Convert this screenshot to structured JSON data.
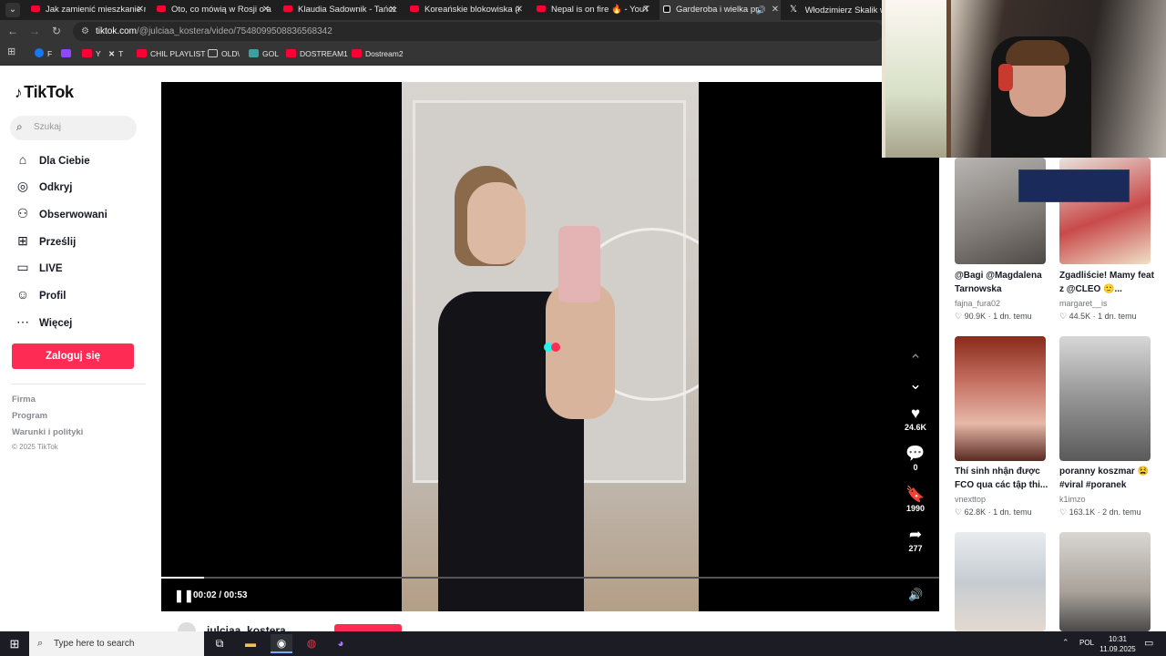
{
  "browser": {
    "tabs": [
      {
        "title": "Jak zamienić mieszkanie n",
        "icon": "youtube-icon"
      },
      {
        "title": "Oto, co mówią w Rosji o a",
        "icon": "youtube-icon"
      },
      {
        "title": "Klaudia Sadownik - Tańcz",
        "icon": "youtube-icon"
      },
      {
        "title": "Koreańskie blokowiska (i",
        "icon": "youtube-icon"
      },
      {
        "title": "Nepal is on fire 🔥 - YouT",
        "icon": "youtube-icon"
      },
      {
        "title": "Garderoba i wielka pr",
        "icon": "tiktok-icon",
        "active": true
      },
      {
        "title": "Włodzimierz Skalik w sej",
        "icon": "x-icon"
      }
    ],
    "url_host": "tiktok.com",
    "url_path": "/@julciaa_kostera/video/7548099508836568342",
    "bookmarks": [
      "F",
      "",
      "Y",
      "T",
      "CHIL PLAYLIST",
      "OLD\\",
      "GOL",
      "DOSTREAM1",
      "Dostream2"
    ]
  },
  "tiktok": {
    "brand": "TikTok",
    "search_placeholder": "Szukaj",
    "nav": [
      "Dla Ciebie",
      "Odkryj",
      "Obserwowani",
      "Prześlij",
      "LIVE",
      "Profil",
      "Więcej"
    ],
    "login_label": "Zaloguj się",
    "footer_links": [
      "Firma",
      "Program",
      "Warunki i polityki"
    ],
    "copyright": "© 2025 TikTok",
    "video": {
      "likes": "24.6K",
      "comments": "0",
      "saves": "1990",
      "shares": "277",
      "time_current": "00:02",
      "time_total": "00:53",
      "progress_fraction": 0.055,
      "author": "julciaa_kostera"
    },
    "recommended": [
      {
        "title": "@Bagi @Magdalena Tarnowska",
        "user": "fajna_fura02",
        "likes": "90.9K",
        "age": "1 dn. temu"
      },
      {
        "title": "Zgadliście! Mamy feat z @CLEO 🙂...",
        "user": "margaret__is",
        "likes": "44.5K",
        "age": "1 dn. temu"
      },
      {
        "title": "Thí sinh nhận được FCO qua các tập thi...",
        "user": "vnexttop",
        "likes": "62.8K",
        "age": "1 dn. temu"
      },
      {
        "title": "poranny koszmar 😫 #viral #poranek",
        "user": "k1imzo",
        "likes": "163.1K",
        "age": "2 dn. temu"
      }
    ]
  },
  "taskbar": {
    "search_placeholder": "Type here to search",
    "lang": "POL",
    "time": "10:31",
    "date": "11.09.2025"
  }
}
